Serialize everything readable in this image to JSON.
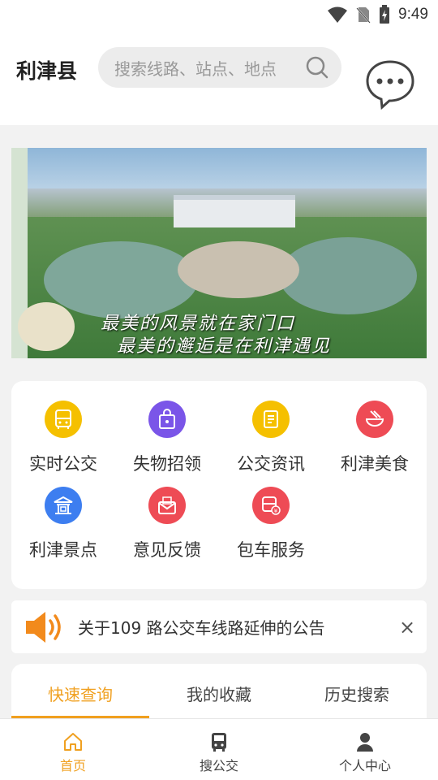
{
  "status_bar": {
    "time": "9:49",
    "icons": [
      "wifi-icon",
      "no-sim-icon",
      "battery-charging-icon"
    ]
  },
  "header": {
    "city": "利津县",
    "search_placeholder": "搜索线路、站点、地点",
    "message_icon": "chat-bubble-icon"
  },
  "banner": {
    "caption_line1": "最美的风景就在家门口",
    "caption_line2": "最美的邂逅是在利津遇见"
  },
  "menu": {
    "items": [
      {
        "label": "实时公交",
        "icon": "bus-icon",
        "color": "#f5c000"
      },
      {
        "label": "失物招领",
        "icon": "lost-bag-icon",
        "color": "#7a55e8"
      },
      {
        "label": "公交资讯",
        "icon": "news-icon",
        "color": "#f5c000"
      },
      {
        "label": "利津美食",
        "icon": "food-bowl-icon",
        "color": "#ee4b55"
      },
      {
        "label": "利津景点",
        "icon": "pavilion-icon",
        "color": "#3d7ef0"
      },
      {
        "label": "意见反馈",
        "icon": "feedback-mail-icon",
        "color": "#ee4b55"
      },
      {
        "label": "包车服务",
        "icon": "charter-bus-icon",
        "color": "#ee4b55"
      }
    ]
  },
  "notice": {
    "text": "关于109 路公交车线路延伸的公告",
    "close": "×"
  },
  "tabs": {
    "items": [
      "快速查询",
      "我的收藏",
      "历史搜索"
    ],
    "active_index": 0,
    "accent": "#f0a020"
  },
  "bottom_nav": {
    "items": [
      {
        "label": "首页",
        "icon": "home-icon"
      },
      {
        "label": "搜公交",
        "icon": "bus-search-icon"
      },
      {
        "label": "个人中心",
        "icon": "person-icon"
      }
    ],
    "active_index": 0
  }
}
